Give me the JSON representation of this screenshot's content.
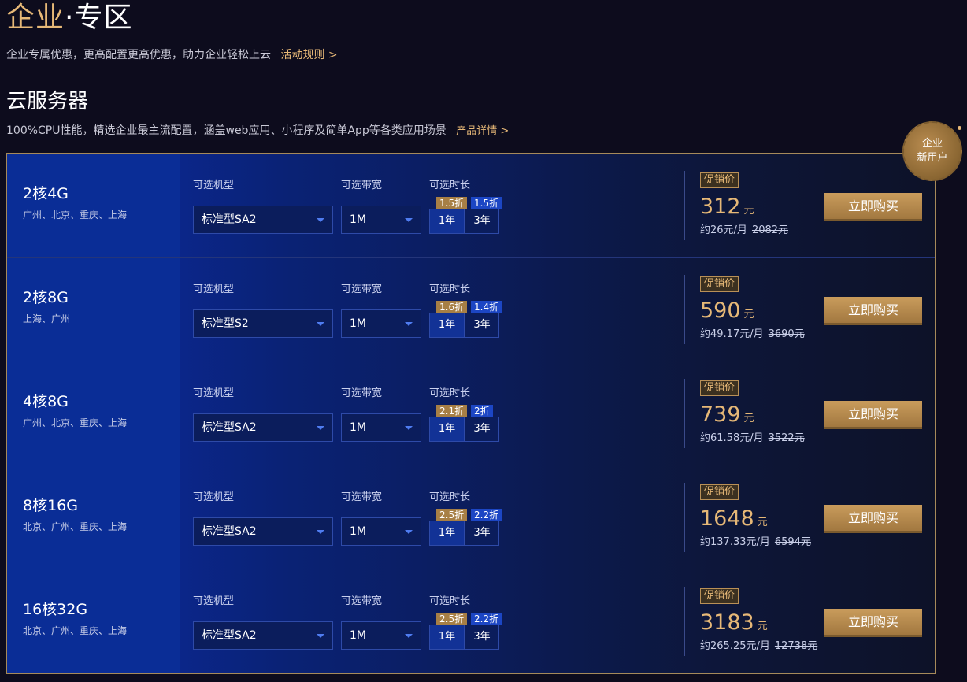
{
  "hero": {
    "title_gold": "企业",
    "title_white": "·专区",
    "subtitle": "企业专属优惠，更高配置更高优惠，助力企业轻松上云",
    "rules_link": "活动规则 >"
  },
  "section": {
    "title": "云服务器",
    "subtitle": "100%CPU性能，精选企业最主流配置，涵盖web应用、小程序及简单App等各类应用场景",
    "detail_link": "产品详情 >"
  },
  "badge": {
    "line1": "企业",
    "line2": "新用户"
  },
  "labels": {
    "model": "可选机型",
    "bandwidth": "可选带宽",
    "duration": "可选时长",
    "promo": "促销价",
    "buy": "立即购买",
    "year1": "1年",
    "year3": "3年",
    "currency": "元"
  },
  "products": [
    {
      "spec": "2核4G",
      "regions": "广州、北京、重庆、上海",
      "model": "标准型SA2",
      "bandwidth": "1M",
      "disc1": "1.5折",
      "disc3": "1.5折",
      "price": "312",
      "monthly": "约26元/月",
      "original": "2082元"
    },
    {
      "spec": "2核8G",
      "regions": "上海、广州",
      "model": "标准型S2",
      "bandwidth": "1M",
      "disc1": "1.6折",
      "disc3": "1.4折",
      "price": "590",
      "monthly": "约49.17元/月",
      "original": "3690元"
    },
    {
      "spec": "4核8G",
      "regions": "广州、北京、重庆、上海",
      "model": "标准型SA2",
      "bandwidth": "1M",
      "disc1": "2.1折",
      "disc3": "2折",
      "price": "739",
      "monthly": "约61.58元/月",
      "original": "3522元"
    },
    {
      "spec": "8核16G",
      "regions": "北京、广州、重庆、上海",
      "model": "标准型SA2",
      "bandwidth": "1M",
      "disc1": "2.5折",
      "disc3": "2.2折",
      "price": "1648",
      "monthly": "约137.33元/月",
      "original": "6594元"
    },
    {
      "spec": "16核32G",
      "regions": "北京、广州、重庆、上海",
      "model": "标准型SA2",
      "bandwidth": "1M",
      "disc1": "2.5折",
      "disc3": "2.2折",
      "price": "3183",
      "monthly": "约265.25元/月",
      "original": "12738元"
    }
  ]
}
